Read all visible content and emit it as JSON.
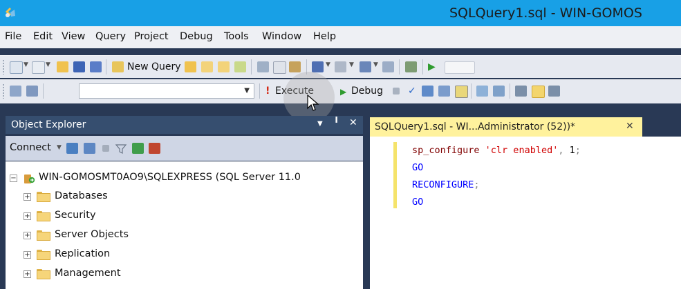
{
  "window": {
    "title": "SQLQuery1.sql - WIN-GOMOS"
  },
  "menu": [
    "File",
    "Edit",
    "View",
    "Query",
    "Project",
    "Debug",
    "Tools",
    "Window",
    "Help"
  ],
  "toolbar1": {
    "new_query_label": "New Query"
  },
  "toolbar2": {
    "database_value": "",
    "execute_label": "Execute",
    "debug_label": "Debug"
  },
  "object_explorer": {
    "title": "Object Explorer",
    "pin_glyph": "╹",
    "close_glyph": "✕",
    "connect_label": "Connect",
    "server_node": "WIN-GOMOSMT0AO9\\SQLEXPRESS (SQL Server 11.0",
    "folders": [
      "Databases",
      "Security",
      "Server Objects",
      "Replication",
      "Management"
    ]
  },
  "editor": {
    "tab_label": "SQLQuery1.sql - WI...Administrator (52))*",
    "close_glyph": "✕",
    "lines": [
      {
        "parts": [
          {
            "text": "sp_configure ",
            "color": "#800000"
          },
          {
            "text": "'clr enabled'",
            "color": "#D00000"
          },
          {
            "text": ", ",
            "color": "#808080"
          },
          {
            "text": "1",
            "color": "#000000"
          },
          {
            "text": ";",
            "color": "#808080"
          }
        ]
      },
      {
        "parts": [
          {
            "text": "GO",
            "color": "#0000FF"
          }
        ]
      },
      {
        "parts": [
          {
            "text": "RECONFIGURE",
            "color": "#0000FF"
          },
          {
            "text": ";",
            "color": "#808080"
          }
        ]
      },
      {
        "parts": [
          {
            "text": "GO",
            "color": "#0000FF"
          }
        ]
      }
    ]
  },
  "colors": {
    "titlebar": "#18A0E6",
    "chrome": "#293955",
    "active_tab": "#FFF29D",
    "change_marker": "#F5E36B"
  }
}
